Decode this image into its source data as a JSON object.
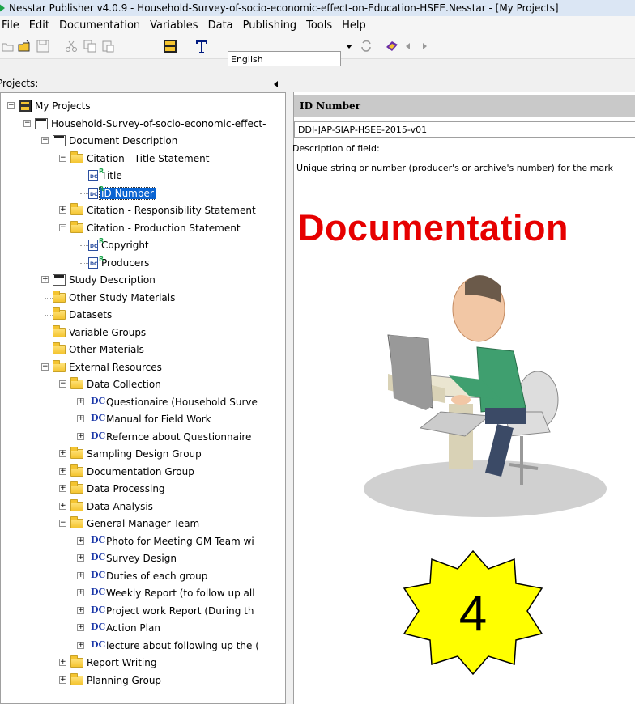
{
  "window": {
    "title": "Nesstar Publisher v4.0.9 - Household-Survey-of-socio-economic-effect-on-Education-HSEE.Nesstar - [My Projects]"
  },
  "menu": [
    "File",
    "Edit",
    "Documentation",
    "Variables",
    "Data",
    "Publishing",
    "Tools",
    "Help"
  ],
  "toolbar": {
    "language": "English",
    "icons": [
      "open-folder-icon",
      "open-icon",
      "save-icon",
      "cut-icon",
      "copy-icon",
      "paste-icon",
      "dataset-icon",
      "text-icon",
      "language-dropdown-icon",
      "refresh-icon",
      "book-icon",
      "back-icon",
      "forward-icon"
    ]
  },
  "projects_label": "Projects:",
  "tree": [
    {
      "label": "My Projects",
      "level": 0,
      "icon": "project-icon",
      "expander": "-"
    },
    {
      "label": "Household-Survey-of-socio-economic-effect-",
      "level": 1,
      "icon": "study-icon",
      "expander": "-"
    },
    {
      "label": "Document Description",
      "level": 2,
      "icon": "doc-description-icon",
      "expander": "-"
    },
    {
      "label": "Citation - Title Statement",
      "level": 3,
      "icon": "folder-icon",
      "expander": "-"
    },
    {
      "label": "Title",
      "level": 4,
      "icon": "dc-field-icon",
      "expander": ""
    },
    {
      "label": "ID Number",
      "level": 4,
      "icon": "dc-field-icon",
      "expander": "",
      "selected": true
    },
    {
      "label": "Citation - Responsibility Statement",
      "level": 3,
      "icon": "folder-icon",
      "expander": "+"
    },
    {
      "label": "Citation - Production Statement",
      "level": 3,
      "icon": "folder-icon",
      "expander": "-"
    },
    {
      "label": "Copyright",
      "level": 4,
      "icon": "dc-field-icon",
      "expander": ""
    },
    {
      "label": "Producers",
      "level": 4,
      "icon": "dc-field-icon",
      "expander": ""
    },
    {
      "label": "Study Description",
      "level": 2,
      "icon": "doc-description-icon",
      "expander": "+"
    },
    {
      "label": "Other Study Materials",
      "level": 2,
      "icon": "folder-icon",
      "expander": ""
    },
    {
      "label": "Datasets",
      "level": 2,
      "icon": "folder-icon",
      "expander": ""
    },
    {
      "label": "Variable Groups",
      "level": 2,
      "icon": "folder-icon",
      "expander": ""
    },
    {
      "label": "Other Materials",
      "level": 2,
      "icon": "folder-icon",
      "expander": ""
    },
    {
      "label": "External Resources",
      "level": 2,
      "icon": "folder-icon",
      "expander": "-"
    },
    {
      "label": "Data Collection",
      "level": 3,
      "icon": "folder-icon",
      "expander": "-"
    },
    {
      "label": "Questionaire (Household Surve",
      "level": 4,
      "icon": "dc-resource-icon",
      "expander": "+"
    },
    {
      "label": "Manual for Field Work",
      "level": 4,
      "icon": "dc-resource-icon",
      "expander": "+"
    },
    {
      "label": "Refernce about Questionnaire",
      "level": 4,
      "icon": "dc-resource-icon",
      "expander": "+"
    },
    {
      "label": "Sampling Design Group",
      "level": 3,
      "icon": "folder-icon",
      "expander": "+"
    },
    {
      "label": "Documentation Group",
      "level": 3,
      "icon": "folder-icon",
      "expander": "+"
    },
    {
      "label": "Data Processing",
      "level": 3,
      "icon": "folder-icon",
      "expander": "+"
    },
    {
      "label": "Data Analysis",
      "level": 3,
      "icon": "folder-icon",
      "expander": "+"
    },
    {
      "label": "General Manager Team",
      "level": 3,
      "icon": "folder-icon",
      "expander": "-"
    },
    {
      "label": "Photo for Meeting GM Team  wi",
      "level": 4,
      "icon": "dc-resource-icon",
      "expander": "+"
    },
    {
      "label": "Survey Design",
      "level": 4,
      "icon": "dc-resource-icon",
      "expander": "+"
    },
    {
      "label": "Duties of each group",
      "level": 4,
      "icon": "dc-resource-icon",
      "expander": "+"
    },
    {
      "label": "Weekly Report (to follow up all",
      "level": 4,
      "icon": "dc-resource-icon",
      "expander": "+"
    },
    {
      "label": "Project work Report (During th",
      "level": 4,
      "icon": "dc-resource-icon",
      "expander": "+"
    },
    {
      "label": "Action Plan",
      "level": 4,
      "icon": "dc-resource-icon",
      "expander": "+"
    },
    {
      "label": "lecture about following up the (",
      "level": 4,
      "icon": "dc-resource-icon",
      "expander": "+"
    },
    {
      "label": "Report Writing",
      "level": 3,
      "icon": "folder-icon",
      "expander": "+"
    },
    {
      "label": "Planning Group",
      "level": 3,
      "icon": "folder-icon",
      "expander": "+"
    }
  ],
  "detail": {
    "field_name": "ID Number",
    "field_value": "DDI-JAP-SIAP-HSEE-2015-v01",
    "description_label": "Description of field:",
    "description_text": "Unique string or number (producer's or archive's number) for the mark"
  },
  "overlay": {
    "headline": "Documentation",
    "step_number": "4",
    "headline_color": "#e60000",
    "badge_color": "#ffff00"
  }
}
